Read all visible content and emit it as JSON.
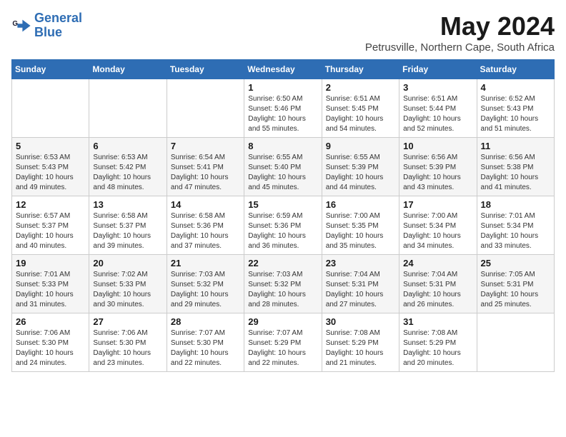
{
  "logo": {
    "line1": "General",
    "line2": "Blue"
  },
  "title": "May 2024",
  "location": "Petrusville, Northern Cape, South Africa",
  "days_of_week": [
    "Sunday",
    "Monday",
    "Tuesday",
    "Wednesday",
    "Thursday",
    "Friday",
    "Saturday"
  ],
  "weeks": [
    [
      {
        "day": "",
        "info": ""
      },
      {
        "day": "",
        "info": ""
      },
      {
        "day": "",
        "info": ""
      },
      {
        "day": "1",
        "info": "Sunrise: 6:50 AM\nSunset: 5:46 PM\nDaylight: 10 hours\nand 55 minutes."
      },
      {
        "day": "2",
        "info": "Sunrise: 6:51 AM\nSunset: 5:45 PM\nDaylight: 10 hours\nand 54 minutes."
      },
      {
        "day": "3",
        "info": "Sunrise: 6:51 AM\nSunset: 5:44 PM\nDaylight: 10 hours\nand 52 minutes."
      },
      {
        "day": "4",
        "info": "Sunrise: 6:52 AM\nSunset: 5:43 PM\nDaylight: 10 hours\nand 51 minutes."
      }
    ],
    [
      {
        "day": "5",
        "info": "Sunrise: 6:53 AM\nSunset: 5:43 PM\nDaylight: 10 hours\nand 49 minutes."
      },
      {
        "day": "6",
        "info": "Sunrise: 6:53 AM\nSunset: 5:42 PM\nDaylight: 10 hours\nand 48 minutes."
      },
      {
        "day": "7",
        "info": "Sunrise: 6:54 AM\nSunset: 5:41 PM\nDaylight: 10 hours\nand 47 minutes."
      },
      {
        "day": "8",
        "info": "Sunrise: 6:55 AM\nSunset: 5:40 PM\nDaylight: 10 hours\nand 45 minutes."
      },
      {
        "day": "9",
        "info": "Sunrise: 6:55 AM\nSunset: 5:39 PM\nDaylight: 10 hours\nand 44 minutes."
      },
      {
        "day": "10",
        "info": "Sunrise: 6:56 AM\nSunset: 5:39 PM\nDaylight: 10 hours\nand 43 minutes."
      },
      {
        "day": "11",
        "info": "Sunrise: 6:56 AM\nSunset: 5:38 PM\nDaylight: 10 hours\nand 41 minutes."
      }
    ],
    [
      {
        "day": "12",
        "info": "Sunrise: 6:57 AM\nSunset: 5:37 PM\nDaylight: 10 hours\nand 40 minutes."
      },
      {
        "day": "13",
        "info": "Sunrise: 6:58 AM\nSunset: 5:37 PM\nDaylight: 10 hours\nand 39 minutes."
      },
      {
        "day": "14",
        "info": "Sunrise: 6:58 AM\nSunset: 5:36 PM\nDaylight: 10 hours\nand 37 minutes."
      },
      {
        "day": "15",
        "info": "Sunrise: 6:59 AM\nSunset: 5:36 PM\nDaylight: 10 hours\nand 36 minutes."
      },
      {
        "day": "16",
        "info": "Sunrise: 7:00 AM\nSunset: 5:35 PM\nDaylight: 10 hours\nand 35 minutes."
      },
      {
        "day": "17",
        "info": "Sunrise: 7:00 AM\nSunset: 5:34 PM\nDaylight: 10 hours\nand 34 minutes."
      },
      {
        "day": "18",
        "info": "Sunrise: 7:01 AM\nSunset: 5:34 PM\nDaylight: 10 hours\nand 33 minutes."
      }
    ],
    [
      {
        "day": "19",
        "info": "Sunrise: 7:01 AM\nSunset: 5:33 PM\nDaylight: 10 hours\nand 31 minutes."
      },
      {
        "day": "20",
        "info": "Sunrise: 7:02 AM\nSunset: 5:33 PM\nDaylight: 10 hours\nand 30 minutes."
      },
      {
        "day": "21",
        "info": "Sunrise: 7:03 AM\nSunset: 5:32 PM\nDaylight: 10 hours\nand 29 minutes."
      },
      {
        "day": "22",
        "info": "Sunrise: 7:03 AM\nSunset: 5:32 PM\nDaylight: 10 hours\nand 28 minutes."
      },
      {
        "day": "23",
        "info": "Sunrise: 7:04 AM\nSunset: 5:31 PM\nDaylight: 10 hours\nand 27 minutes."
      },
      {
        "day": "24",
        "info": "Sunrise: 7:04 AM\nSunset: 5:31 PM\nDaylight: 10 hours\nand 26 minutes."
      },
      {
        "day": "25",
        "info": "Sunrise: 7:05 AM\nSunset: 5:31 PM\nDaylight: 10 hours\nand 25 minutes."
      }
    ],
    [
      {
        "day": "26",
        "info": "Sunrise: 7:06 AM\nSunset: 5:30 PM\nDaylight: 10 hours\nand 24 minutes."
      },
      {
        "day": "27",
        "info": "Sunrise: 7:06 AM\nSunset: 5:30 PM\nDaylight: 10 hours\nand 23 minutes."
      },
      {
        "day": "28",
        "info": "Sunrise: 7:07 AM\nSunset: 5:30 PM\nDaylight: 10 hours\nand 22 minutes."
      },
      {
        "day": "29",
        "info": "Sunrise: 7:07 AM\nSunset: 5:29 PM\nDaylight: 10 hours\nand 22 minutes."
      },
      {
        "day": "30",
        "info": "Sunrise: 7:08 AM\nSunset: 5:29 PM\nDaylight: 10 hours\nand 21 minutes."
      },
      {
        "day": "31",
        "info": "Sunrise: 7:08 AM\nSunset: 5:29 PM\nDaylight: 10 hours\nand 20 minutes."
      },
      {
        "day": "",
        "info": ""
      }
    ]
  ]
}
